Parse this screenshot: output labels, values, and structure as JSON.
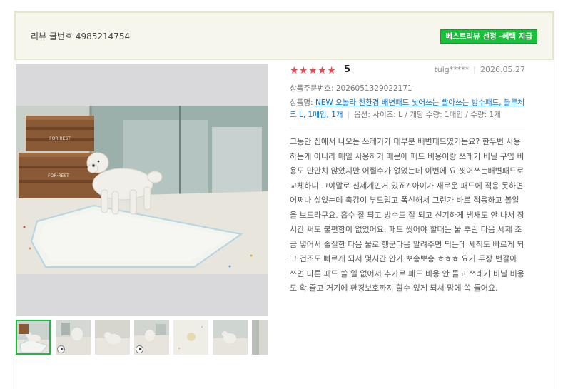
{
  "header": {
    "review_number": "리뷰 글번호 4985214754",
    "best_badge": "베스트리뷰 선정 -혜택 지급"
  },
  "review": {
    "stars": "★★★★★",
    "score": "5",
    "author": "tuig*****",
    "date": "2026.05.27",
    "order_number": "상품주문번호: 2026051329022171",
    "product_prefix": "상품명: ",
    "product_link": "NEW 오놀라 친환경 배변패드 씻어쓰는 빨아쓰는 방수패드, 블루체크 L, 1매입, 1개",
    "options": "옵션: 사이즈: L / 개당 수량: 1매입 / 수량: 1개",
    "content": "그동안 집에서 나오는 쓰레기가 대부분 배변패드였거든요? 한두번 사용하는게 아니라 매일 사용하기 때문에 패드 비용이랑 쓰레기 비닐 구입 비용도 만만치 않았지만 어쩔수가 없었는데 이번에 요 씻어쓰는배변패드로 교체하니 그야말로 신세계인거 있죠? 아이가 새로운 패드에 적응 못하면 어쩌나 싶었는데 촉감이 부드럽고 폭신해서 그런가 바로 적응하고 볼일을 보드라구요. 흡수 잘 되고 방수도 잘 되고 신기하게 냄새도 안 나서 장시간 써도 불편함이 없었어요. 패드 씻어야 할때는 물 뿌린 다음 세제 조금 넣어서 솔질한 다음 물로 헹군다음 말려주면 되는데 세척도 빠르게 되고 건조도 빠르게 되서 몇시간 안가 뽀송뽀송 ㅎㅎㅎ 요거 두장 번갈아 쓰면 다른 패드 쓸 일 없어서 추가로 패드 비용 안 들고 쓰레기 비닐 비용도 확 줄고 거기에 환경보호까지 할수 있게 되서 맘에 쏙 들어요."
  },
  "photo": {
    "crate_text": "FOR·REST"
  },
  "thumbnails": [
    {
      "active": true,
      "video": false
    },
    {
      "active": false,
      "video": true
    },
    {
      "active": false,
      "video": false
    },
    {
      "active": false,
      "video": true
    },
    {
      "active": false,
      "video": false
    },
    {
      "active": false,
      "video": false
    },
    {
      "active": false,
      "video": false
    }
  ],
  "colors": {
    "badge_green": "#19c13a",
    "star_red": "#f0454f",
    "link_blue": "#0b73c7",
    "header_bg": "#f6f6ec"
  }
}
